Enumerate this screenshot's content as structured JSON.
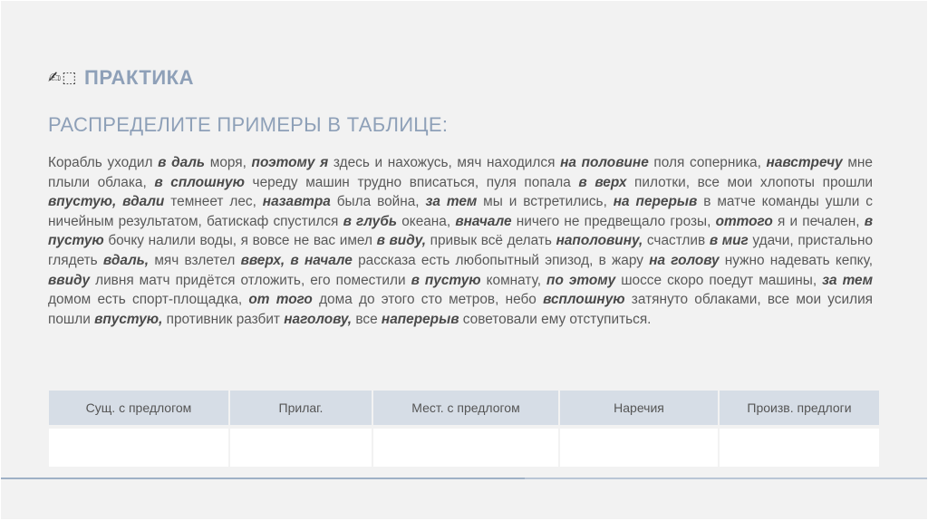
{
  "header": {
    "icon": "✍⬚",
    "title": "ПРАКТИКА"
  },
  "subtitle": "РАСПРЕДЕЛИТЕ ПРИМЕРЫ В ТАБЛИЦЕ:",
  "text_segments": [
    {
      "t": "Корабль уходил ",
      "b": false
    },
    {
      "t": "в даль",
      "b": true
    },
    {
      "t": " моря, ",
      "b": false
    },
    {
      "t": "поэтому я",
      "b": true
    },
    {
      "t": " здесь и нахожусь, мяч находился ",
      "b": false
    },
    {
      "t": "на половине",
      "b": true
    },
    {
      "t": " поля соперника, ",
      "b": false
    },
    {
      "t": "навстречу",
      "b": true
    },
    {
      "t": " мне плыли облака, ",
      "b": false
    },
    {
      "t": "в сплошную",
      "b": true
    },
    {
      "t": " череду машин трудно вписаться, пуля попала ",
      "b": false
    },
    {
      "t": "в верх",
      "b": true
    },
    {
      "t": " пилотки, все мои хлопоты прошли ",
      "b": false
    },
    {
      "t": "впустую, вдали",
      "b": true
    },
    {
      "t": " темнеет лес, ",
      "b": false
    },
    {
      "t": "назавтра",
      "b": true
    },
    {
      "t": " была война, ",
      "b": false
    },
    {
      "t": "за тем",
      "b": true
    },
    {
      "t": " мы и встретились, ",
      "b": false
    },
    {
      "t": "на перерыв",
      "b": true
    },
    {
      "t": " в матче команды ушли с ничейным результатом, батискаф спустился ",
      "b": false
    },
    {
      "t": "в глубь",
      "b": true
    },
    {
      "t": " океана, ",
      "b": false
    },
    {
      "t": "вначале",
      "b": true
    },
    {
      "t": " ничего не предвещало грозы, ",
      "b": false
    },
    {
      "t": "оттого",
      "b": true
    },
    {
      "t": " я и печален, ",
      "b": false
    },
    {
      "t": "в пустую",
      "b": true
    },
    {
      "t": " бочку налили воды, я вовсе не вас имел ",
      "b": false
    },
    {
      "t": "в виду,",
      "b": true
    },
    {
      "t": " привык всё делать ",
      "b": false
    },
    {
      "t": "наполовину,",
      "b": true
    },
    {
      "t": " счастлив ",
      "b": false
    },
    {
      "t": "в миг",
      "b": true
    },
    {
      "t": " удачи, пристально глядеть ",
      "b": false
    },
    {
      "t": "вдаль,",
      "b": true
    },
    {
      "t": " мяч взлетел ",
      "b": false
    },
    {
      "t": "вверх, в начале",
      "b": true
    },
    {
      "t": " рассказа есть любопытный эпизод, в жару ",
      "b": false
    },
    {
      "t": "на голову",
      "b": true
    },
    {
      "t": " нужно надевать кепку, ",
      "b": false
    },
    {
      "t": "ввиду",
      "b": true
    },
    {
      "t": " ливня матч придётся отложить, его поместили ",
      "b": false
    },
    {
      "t": "в пустую",
      "b": true
    },
    {
      "t": " комнату, ",
      "b": false
    },
    {
      "t": "по этому",
      "b": true
    },
    {
      "t": " шоссе скоро поедут машины, ",
      "b": false
    },
    {
      "t": "за тем",
      "b": true
    },
    {
      "t": " домом есть спорт-площадка, ",
      "b": false
    },
    {
      "t": "от того",
      "b": true
    },
    {
      "t": " дома до этого сто метров, небо ",
      "b": false
    },
    {
      "t": "всплошную",
      "b": true
    },
    {
      "t": " затянуто облаками, все мои усилия пошли ",
      "b": false
    },
    {
      "t": "впустую,",
      "b": true
    },
    {
      "t": " противник разбит ",
      "b": false
    },
    {
      "t": "наголову,",
      "b": true
    },
    {
      "t": " все ",
      "b": false
    },
    {
      "t": "наперерыв",
      "b": true
    },
    {
      "t": " советовали ему отступиться.",
      "b": false
    }
  ],
  "table": {
    "headers": [
      "Сущ. с предлогом",
      "Прилаг.",
      "Мест. с предлогом",
      "Наречия",
      "Произв. предлоги"
    ],
    "rows": [
      [
        "",
        "",
        "",
        "",
        ""
      ]
    ]
  }
}
